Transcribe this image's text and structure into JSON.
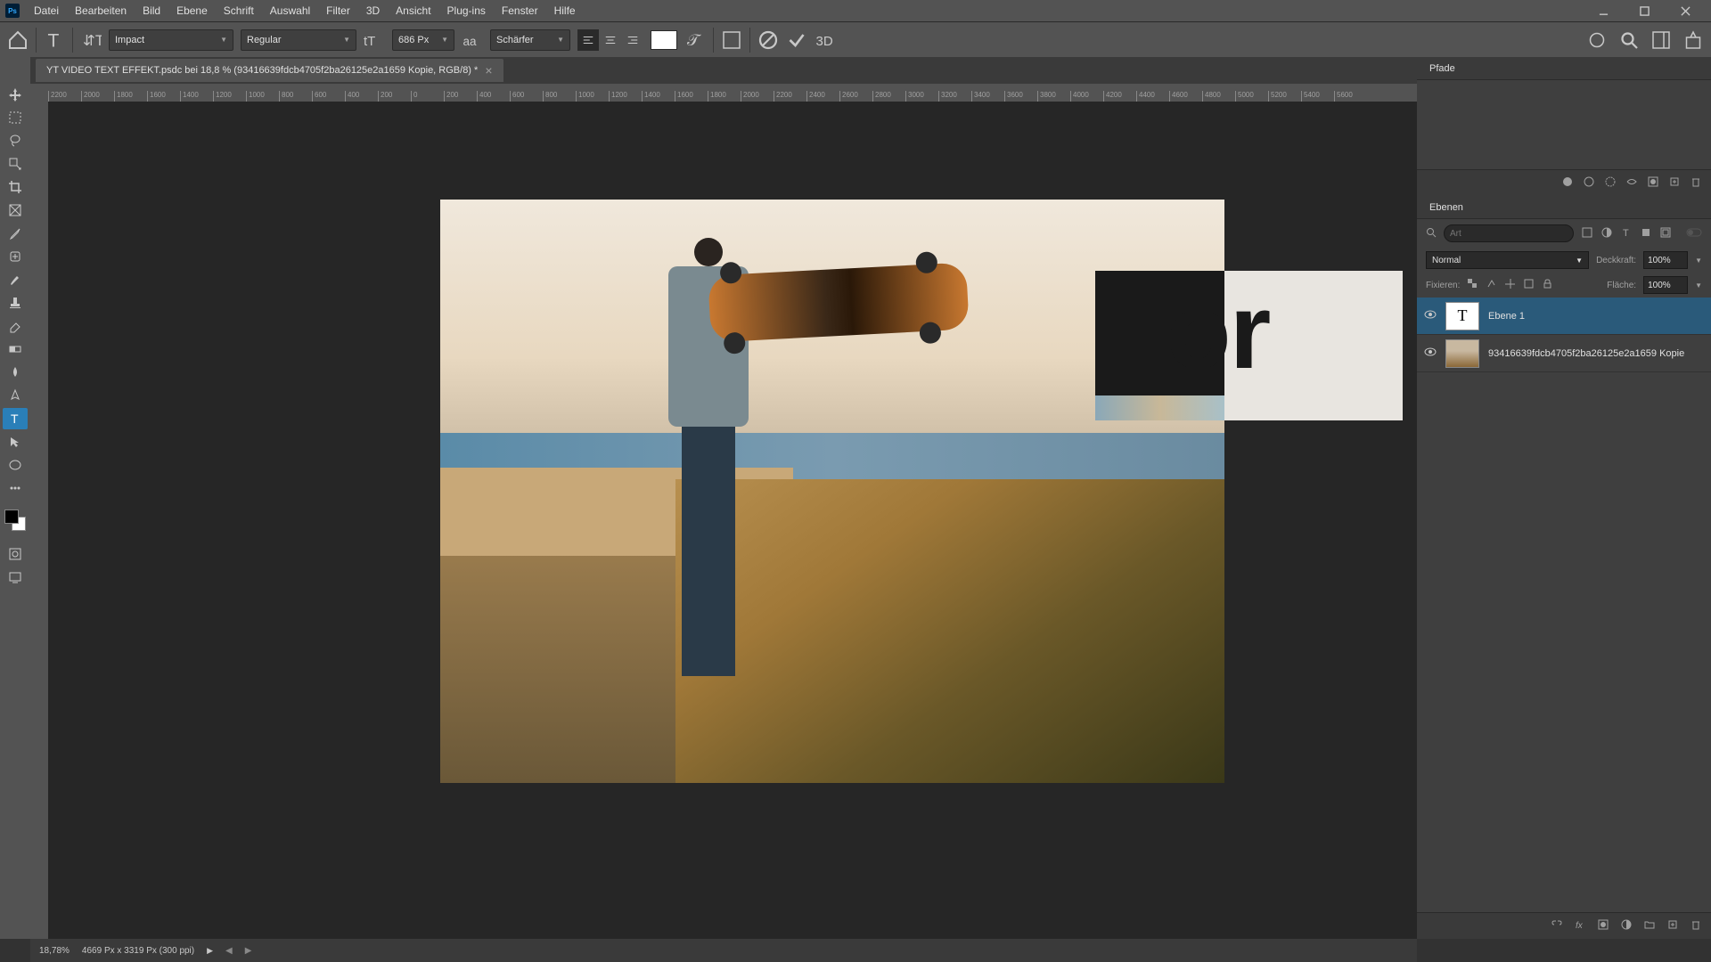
{
  "menu": {
    "items": [
      "Datei",
      "Bearbeiten",
      "Bild",
      "Ebene",
      "Schrift",
      "Auswahl",
      "Filter",
      "3D",
      "Ansicht",
      "Plug-ins",
      "Fenster",
      "Hilfe"
    ]
  },
  "options": {
    "font_family": "Impact",
    "font_style": "Regular",
    "font_size": "686 Px",
    "antialias": "Schärfer",
    "color": "#ffffff"
  },
  "document": {
    "tab_title": "YT VIDEO TEXT EFFEKT.psdc bei 18,8 % (93416639fdcb4705f2ba26125e2a1659 Kopie, RGB/8) *",
    "lorem": "Lor"
  },
  "ruler": {
    "ticks": [
      "2200",
      "2000",
      "1800",
      "1600",
      "1400",
      "1200",
      "1000",
      "800",
      "600",
      "400",
      "200",
      "0",
      "200",
      "400",
      "600",
      "800",
      "1000",
      "1200",
      "1400",
      "1600",
      "1800",
      "2000",
      "2200",
      "2400",
      "2600",
      "2800",
      "3000",
      "3200",
      "3400",
      "3600",
      "3800",
      "4000",
      "4200",
      "4400",
      "4600",
      "4800",
      "5000",
      "5200",
      "5400",
      "5600"
    ]
  },
  "panels": {
    "paths_label": "Pfade",
    "layers_label": "Ebenen",
    "search_placeholder": "Art",
    "blend_mode": "Normal",
    "opacity_label": "Deckkraft:",
    "opacity_value": "100%",
    "lock_label": "Fixieren:",
    "fill_label": "Fläche:",
    "fill_value": "100%",
    "layers": [
      {
        "name": "Ebene 1",
        "type": "text",
        "selected": true
      },
      {
        "name": "93416639fdcb4705f2ba26125e2a1659  Kopie",
        "type": "image",
        "selected": false
      }
    ]
  },
  "status": {
    "zoom": "18,78%",
    "doc_info": "4669 Px x 3319 Px (300 ppi)"
  },
  "icons": {
    "ps": "Ps"
  }
}
